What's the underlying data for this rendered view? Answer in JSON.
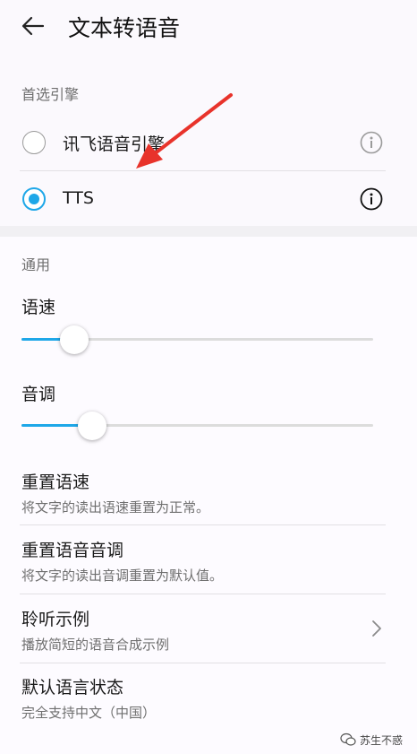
{
  "header": {
    "title": "文本转语音",
    "back_icon": "arrow-left-icon"
  },
  "engines": {
    "section_label": "首选引擎",
    "items": [
      {
        "label": "讯飞语音引擎",
        "selected": false
      },
      {
        "label": "TTS",
        "selected": true
      }
    ]
  },
  "general": {
    "section_label": "通用",
    "speech_rate": {
      "label": "语速",
      "value": 0.15
    },
    "pitch": {
      "label": "音调",
      "value": 0.2
    }
  },
  "items": [
    {
      "title": "重置语速",
      "subtitle": "将文字的读出语速重置为正常。"
    },
    {
      "title": "重置语音音调",
      "subtitle": "将文字的读出音调重置为默认值。"
    },
    {
      "title": "聆听示例",
      "subtitle": "播放简短的语音合成示例"
    },
    {
      "title": "默认语言状态",
      "subtitle": "完全支持中文（中国）"
    }
  ],
  "watermark": {
    "text": "苏生不惑"
  },
  "colors": {
    "accent": "#1ea7e8",
    "annotation": "#e8332b"
  }
}
